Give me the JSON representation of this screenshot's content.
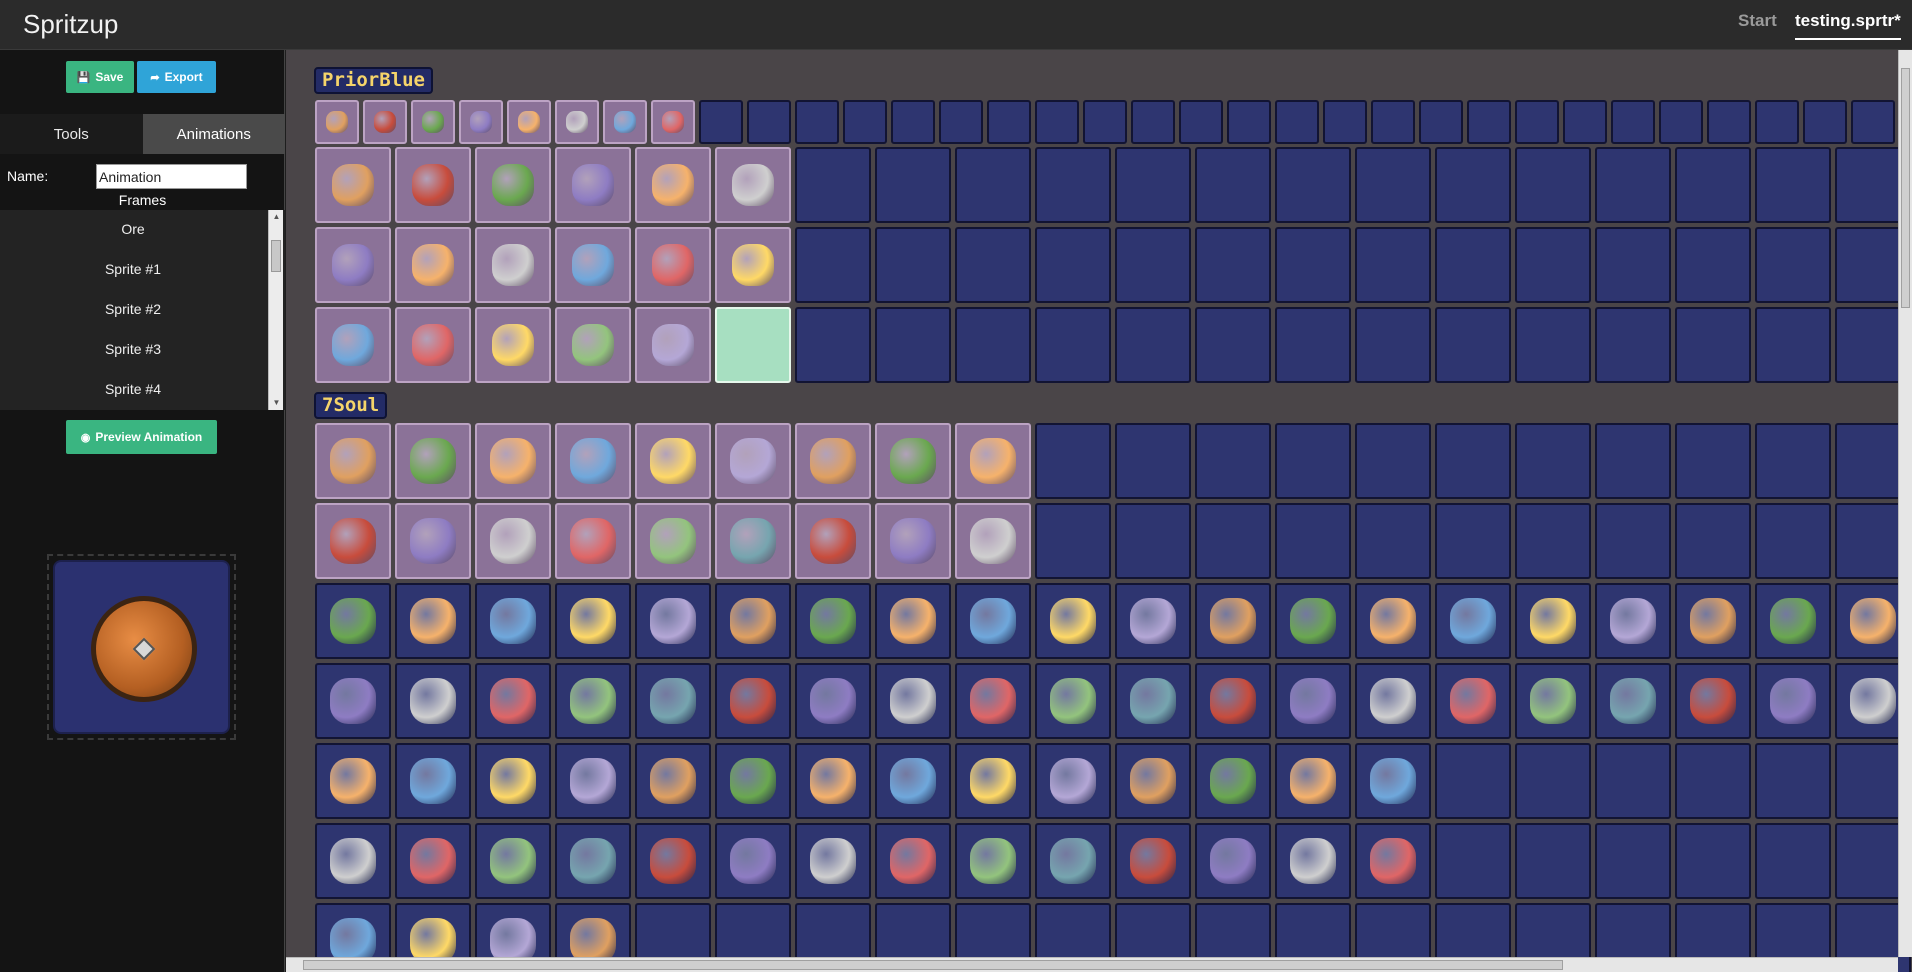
{
  "app": {
    "title": "Spritzup"
  },
  "nav": {
    "start": "Start",
    "file": "testing.sprtr*"
  },
  "toolbar": {
    "save_label": "Save",
    "export_label": "Export"
  },
  "tabs": {
    "tools": "Tools",
    "animations": "Animations"
  },
  "animation": {
    "name_label": "Name:",
    "name_value": "Animation",
    "frames_label": "Frames",
    "frames": [
      "Ore",
      "Sprite #1",
      "Sprite #2",
      "Sprite #3",
      "Sprite #4"
    ],
    "preview_label": "Preview Animation"
  },
  "groups": [
    {
      "label": "PriorBlue"
    },
    {
      "label": "7Soul"
    }
  ],
  "colors": {
    "accent_green": "#3ab581",
    "accent_blue": "#2fa4d8",
    "cell_empty": "#2e3570",
    "cell_used": "#8b7298",
    "cell_selected": "#a7dfc1"
  }
}
